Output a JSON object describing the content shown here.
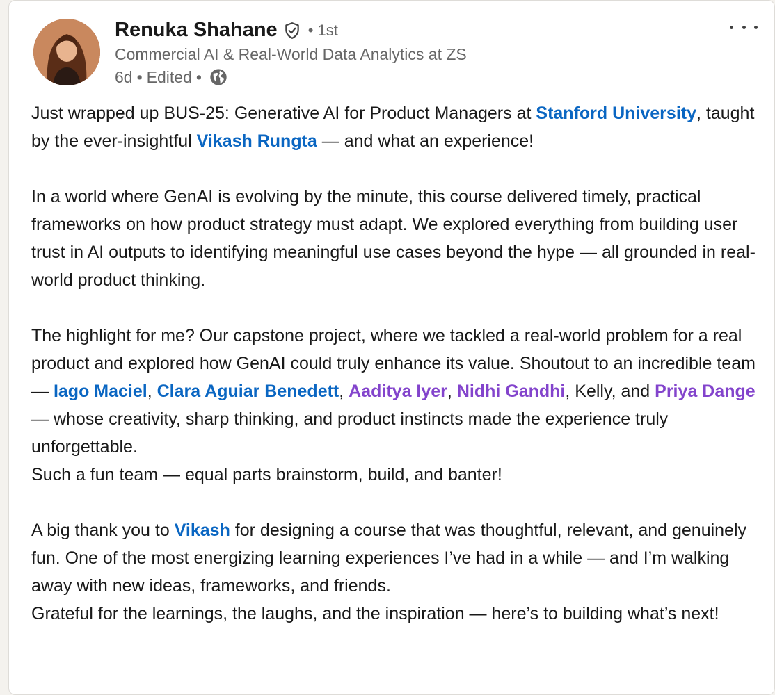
{
  "author": {
    "name": "Renuka Shahane",
    "degree": "• 1st",
    "headline": "Commercial AI & Real-World Data Analytics at ZS",
    "time": "6d",
    "sep1": "•",
    "edited": "Edited",
    "sep2": "•"
  },
  "colors": {
    "link_blue": "#0a66c2",
    "link_purple": "#8344cc",
    "text": "#1f1f1f",
    "muted": "#666666"
  },
  "icons": {
    "verified": "shield-check-icon",
    "visibility": "globe-icon",
    "menu": "more-horizontal-icon"
  },
  "post": {
    "p1": {
      "t1": "Just wrapped up BUS-25: Generative AI for Product Managers at ",
      "m1": "Stanford University",
      "t2": ", taught by the ever-insightful ",
      "m2": "Vikash Rungta",
      "t3": " — and what an experience!"
    },
    "p2": "In a world where GenAI is evolving by the minute, this course delivered timely, practical frameworks on how product strategy must adapt. We explored everything from building user trust in AI outputs to identifying meaningful use cases beyond the hype — all grounded in real-world product thinking.",
    "p3": {
      "t1": "The highlight for me? Our capstone project, where we tackled a real-world problem for a real product and explored how GenAI could truly enhance its value. Shoutout to an incredible team — ",
      "m1": "Iago Maciel",
      "t2": ", ",
      "m2": "Clara Aguiar Benedett",
      "t3": ", ",
      "m3": "Aaditya Iyer",
      "t4": ", ",
      "m4": "Nidhi Gandhi",
      "t5": ", Kelly, and ",
      "m5": "Priya Dange",
      "t6": " — whose creativity, sharp thinking, and product instincts made the experience truly unforgettable.",
      "line2": "Such a fun team — equal parts brainstorm, build, and banter!"
    },
    "p4": {
      "t1": "A big thank you to ",
      "m1": "Vikash",
      "t2": " for designing a course that was thoughtful, relevant, and genuinely fun. One of the most energizing learning experiences I’ve had in a while — and I’m walking away with new ideas, frameworks, and friends.",
      "line2": "Grateful for the learnings, the laughs, and the inspiration — here’s to building what’s next!"
    }
  }
}
